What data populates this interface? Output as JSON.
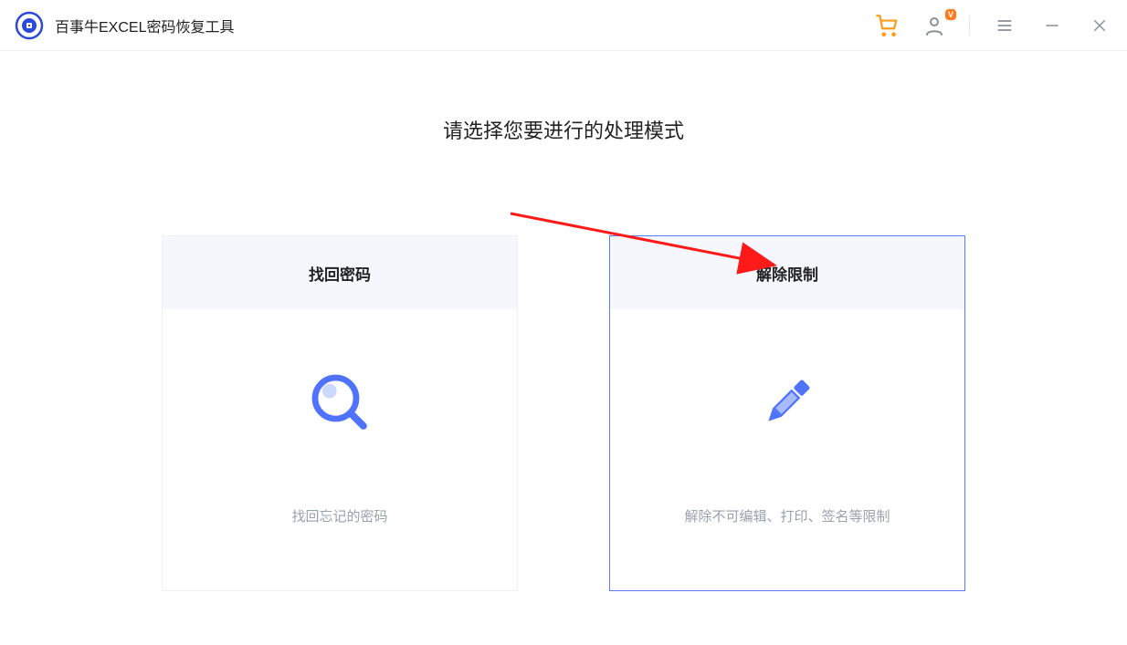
{
  "header": {
    "app_title": "百事牛EXCEL密码恢复工具",
    "user_badge": "V"
  },
  "main": {
    "heading": "请选择您要进行的处理模式",
    "cards": [
      {
        "title": "找回密码",
        "description": "找回忘记的密码",
        "selected": false
      },
      {
        "title": "解除限制",
        "description": "解除不可编辑、打印、签名等限制",
        "selected": true
      }
    ]
  },
  "colors": {
    "accent": "#5b7bff",
    "cart": "#ff9a1a",
    "arrow": "#ff1a1a"
  }
}
